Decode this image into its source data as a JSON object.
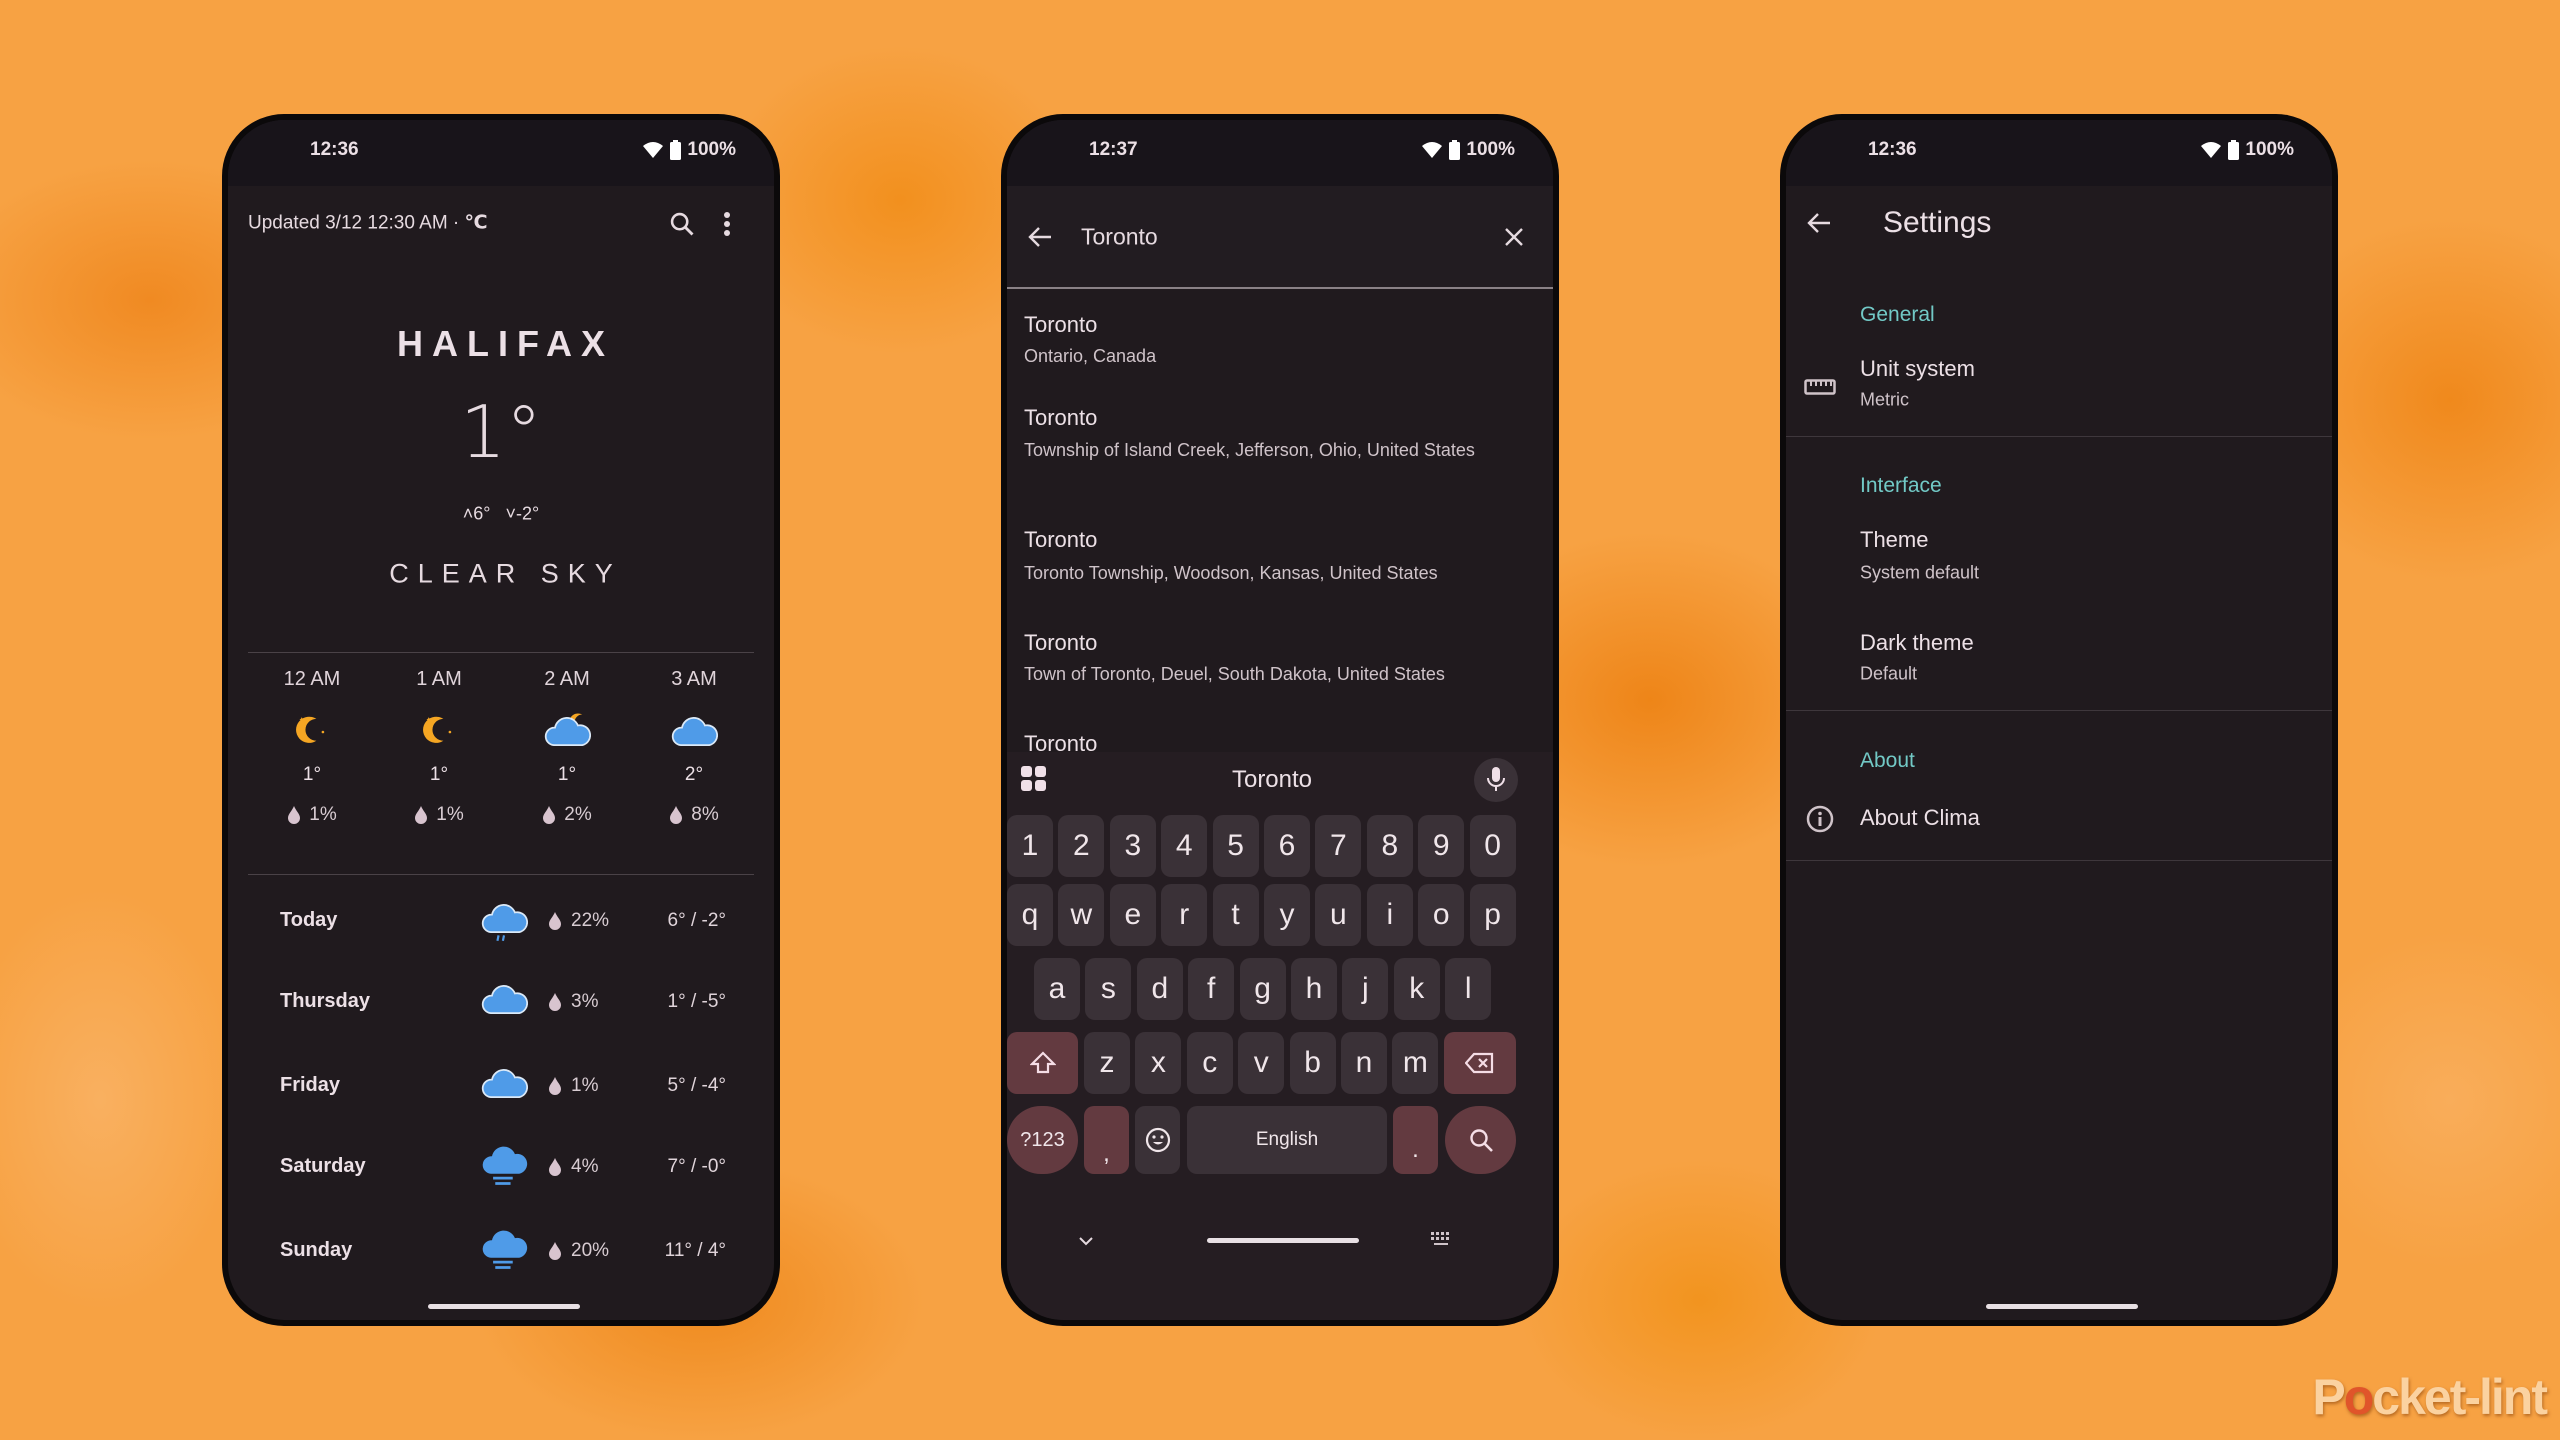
{
  "weather_phone": {
    "status": {
      "time": "12:36",
      "battery": "100%"
    },
    "updated": "Updated 3/12 12:30 AM · ",
    "unit": "℃",
    "city": "HALIFAX",
    "current_temp": "1°",
    "high": "6°",
    "low": "-2°",
    "condition": "CLEAR SKY",
    "hourly": [
      {
        "time": "12 AM",
        "icon": "moon",
        "temp": "1°",
        "precip": "1%"
      },
      {
        "time": "1 AM",
        "icon": "moon",
        "temp": "1°",
        "precip": "1%"
      },
      {
        "time": "2 AM",
        "icon": "cloud-moon",
        "temp": "1°",
        "precip": "2%"
      },
      {
        "time": "3 AM",
        "icon": "cloudy",
        "temp": "2°",
        "precip": "8%"
      }
    ],
    "daily": [
      {
        "day": "Today",
        "icon": "rain",
        "precip": "22%",
        "temps": "6° / -2°"
      },
      {
        "day": "Thursday",
        "icon": "cloudy",
        "precip": "3%",
        "temps": "1° / -5°"
      },
      {
        "day": "Friday",
        "icon": "cloudy",
        "precip": "1%",
        "temps": "5° / -4°"
      },
      {
        "day": "Saturday",
        "icon": "fog",
        "precip": "4%",
        "temps": "7° / -0°"
      },
      {
        "day": "Sunday",
        "icon": "fog",
        "precip": "20%",
        "temps": "11° / 4°"
      }
    ]
  },
  "search_phone": {
    "status": {
      "time": "12:37",
      "battery": "100%"
    },
    "query": "Toronto",
    "results": [
      {
        "title": "Toronto",
        "subtitle": "Ontario, Canada"
      },
      {
        "title": "Toronto",
        "subtitle": "Township of Island Creek, Jefferson, Ohio, United States"
      },
      {
        "title": "Toronto",
        "subtitle": "Toronto Township, Woodson, Kansas, United States"
      },
      {
        "title": "Toronto",
        "subtitle": "Town of Toronto, Deuel, South Dakota, United States"
      },
      {
        "title": "Toronto",
        "subtitle": ""
      }
    ],
    "keyboard": {
      "suggestion": "Toronto",
      "rows": [
        [
          "1",
          "2",
          "3",
          "4",
          "5",
          "6",
          "7",
          "8",
          "9",
          "0"
        ],
        [
          "q",
          "w",
          "e",
          "r",
          "t",
          "y",
          "u",
          "i",
          "o",
          "p"
        ],
        [
          "a",
          "s",
          "d",
          "f",
          "g",
          "h",
          "j",
          "k",
          "l"
        ],
        [
          "z",
          "x",
          "c",
          "v",
          "b",
          "n",
          "m"
        ]
      ],
      "symbols_label": "?123",
      "comma": ",",
      "period": ".",
      "space_label": "English"
    }
  },
  "settings_phone": {
    "status": {
      "time": "12:36",
      "battery": "100%"
    },
    "title": "Settings",
    "sections": [
      {
        "header": "General",
        "items": [
          {
            "title": "Unit system",
            "value": "Metric",
            "icon": "ruler-icon"
          }
        ]
      },
      {
        "header": "Interface",
        "items": [
          {
            "title": "Theme",
            "value": "System default"
          },
          {
            "title": "Dark theme",
            "value": "Default"
          }
        ]
      },
      {
        "header": "About",
        "items": [
          {
            "title": "About Clima",
            "icon": "info-icon"
          }
        ]
      }
    ]
  },
  "watermark": "Pocketlint",
  "colors": {
    "background": "#f7a243",
    "app_bg": "#201a1e",
    "accent": "#72c9c6",
    "key": "#3a3137",
    "special_key": "#633a40",
    "weather_blue": "#4f9be8",
    "moon": "#f5a623"
  }
}
